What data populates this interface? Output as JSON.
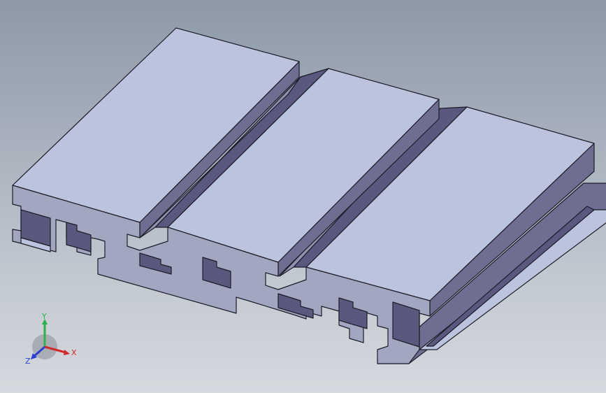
{
  "viewport": {
    "background_top": "#8e99a8",
    "background_bottom": "#d6d9de"
  },
  "model": {
    "part": "aluminum-extrusion-profile",
    "colors": {
      "top": "#bcc3de",
      "side": "#6f6d92",
      "side_dark": "#5b5880",
      "front": "#a3a6c0",
      "edge": "#1c1c28"
    }
  },
  "triad": {
    "x_label": "X",
    "y_label": "Y",
    "z_label": "Z",
    "x_color": "#d02a2a",
    "y_color": "#2bb24a",
    "z_color": "#2a3fd0"
  }
}
